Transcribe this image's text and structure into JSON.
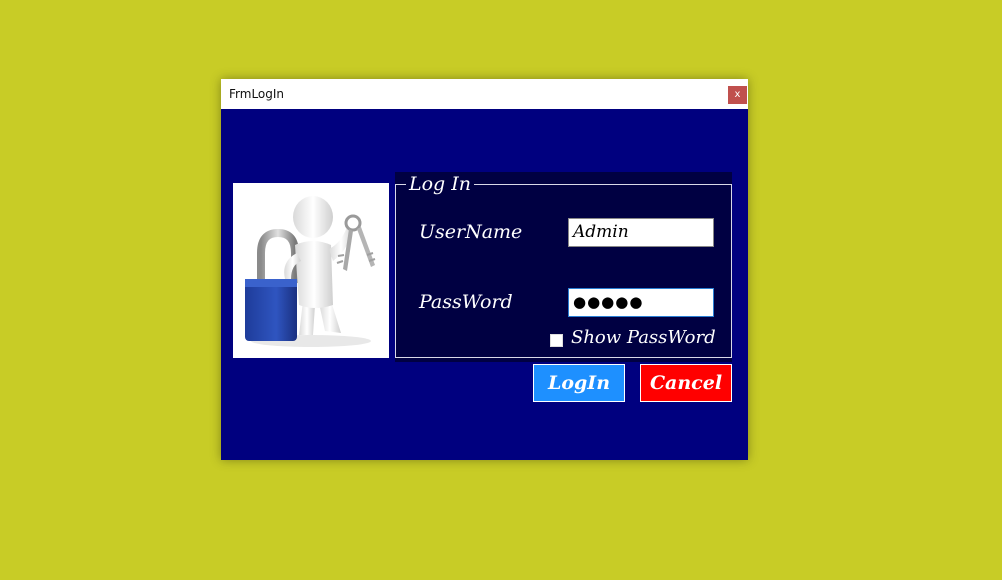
{
  "window": {
    "title": "FrmLogIn",
    "close_label": "x",
    "background_color": "#00007f"
  },
  "picture": {
    "icon": "person-with-padlock-and-keys"
  },
  "login_group": {
    "legend": "Log In",
    "username_label": "UserName",
    "username_value": "Admin",
    "password_label": "PassWord",
    "password_value": "●●●●●",
    "show_password_label": "Show PassWord",
    "show_password_checked": false
  },
  "buttons": {
    "login_label": "LogIn",
    "login_color": "#1e90ff",
    "cancel_label": "Cancel",
    "cancel_color": "#ff0000"
  },
  "colors": {
    "desktop": "#c8cc26",
    "panel": "#000042"
  }
}
